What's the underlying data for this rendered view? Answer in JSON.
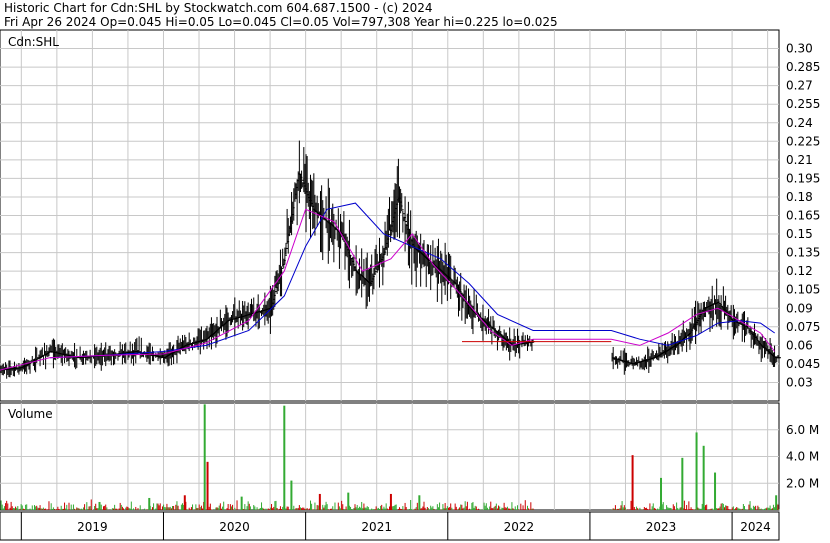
{
  "header": {
    "line1": "Historic Chart for Cdn:SHL by Stockwatch.com 604.687.1500 - (c) 2024",
    "line2": "Fri Apr 26 2024   Op=0.045  Hi=0.05  Lo=0.045  Cl=0.05  Vol=797,308  Year hi=0.225  lo=0.025"
  },
  "colors": {
    "price_bar": "#000000",
    "ma_short": "#cc00cc",
    "ma_long": "#0000cc",
    "vol_up": "#33aa33",
    "vol_down": "#cc0000",
    "grid": "#c8c8c8"
  },
  "chart_data": [
    {
      "type": "line",
      "title": "Cdn:SHL",
      "x_unit": "date (fractional year)",
      "ylim": [
        0.015,
        0.315
      ],
      "y_ticks": [
        "0.30",
        "0.285",
        "0.27",
        "0.255",
        "0.24",
        "0.225",
        "0.21",
        "0.195",
        "0.18",
        "0.165",
        "0.15",
        "0.135",
        "0.12",
        "0.105",
        "0.09",
        "0.075",
        "0.06",
        "0.045",
        "0.03"
      ],
      "grid": true,
      "series": [
        {
          "role": "price_close",
          "x": [
            2018.85,
            2019.0,
            2019.2,
            2019.4,
            2019.6,
            2019.8,
            2020.0,
            2020.15,
            2020.3,
            2020.45,
            2020.6,
            2020.75,
            2020.85,
            2020.95,
            2021.05,
            2021.15,
            2021.25,
            2021.35,
            2021.45,
            2021.55,
            2021.65,
            2021.75,
            2021.85,
            2021.95,
            2022.05,
            2022.15,
            2022.25,
            2022.35,
            2022.45,
            2022.6,
            2023.15,
            2023.3,
            2023.45,
            2023.6,
            2023.7,
            2023.8,
            2023.9,
            2024.0,
            2024.1,
            2024.2,
            2024.3
          ],
          "y": [
            0.04,
            0.042,
            0.055,
            0.05,
            0.052,
            0.055,
            0.05,
            0.06,
            0.065,
            0.08,
            0.085,
            0.09,
            0.13,
            0.2,
            0.17,
            0.16,
            0.15,
            0.12,
            0.11,
            0.135,
            0.18,
            0.14,
            0.13,
            0.12,
            0.11,
            0.09,
            0.08,
            0.07,
            0.06,
            0.063,
            0.05,
            0.045,
            0.05,
            0.06,
            0.07,
            0.09,
            0.095,
            0.08,
            0.075,
            0.06,
            0.05
          ]
        },
        {
          "role": "ma_short",
          "x": [
            2018.85,
            2019.2,
            2019.6,
            2020.0,
            2020.3,
            2020.6,
            2020.85,
            2021.0,
            2021.2,
            2021.4,
            2021.6,
            2021.75,
            2021.9,
            2022.1,
            2022.3,
            2022.45,
            2022.6,
            2023.15,
            2023.35,
            2023.55,
            2023.75,
            2023.9,
            2024.05,
            2024.2,
            2024.3
          ],
          "y": [
            0.04,
            0.05,
            0.052,
            0.053,
            0.062,
            0.08,
            0.12,
            0.17,
            0.16,
            0.12,
            0.13,
            0.15,
            0.125,
            0.1,
            0.072,
            0.06,
            0.065,
            0.065,
            0.06,
            0.07,
            0.085,
            0.09,
            0.08,
            0.07,
            0.055
          ]
        },
        {
          "role": "ma_long",
          "x": [
            2019.2,
            2019.6,
            2020.0,
            2020.3,
            2020.6,
            2020.85,
            2021.0,
            2021.15,
            2021.35,
            2021.55,
            2021.75,
            2021.95,
            2022.15,
            2022.35,
            2022.6,
            2023.15,
            2023.35,
            2023.55,
            2023.75,
            2023.9,
            2024.05,
            2024.2,
            2024.3
          ],
          "y": [
            0.05,
            0.052,
            0.055,
            0.06,
            0.072,
            0.1,
            0.14,
            0.17,
            0.175,
            0.15,
            0.14,
            0.13,
            0.11,
            0.085,
            0.072,
            0.072,
            0.065,
            0.06,
            0.068,
            0.078,
            0.08,
            0.078,
            0.07
          ]
        }
      ]
    },
    {
      "type": "bar",
      "title": "Volume",
      "x_unit": "date (fractional year)",
      "y_unit": "shares (millions)",
      "ylim": [
        0,
        8.0
      ],
      "y_ticks": [
        "6.0 M",
        "4.0 M",
        "2.0 M"
      ],
      "x_ticks": [
        "2019",
        "2020",
        "2021",
        "2022",
        "2023",
        "2024"
      ],
      "x_tick_positions": [
        2019.0,
        2020.0,
        2021.0,
        2022.0,
        2023.0,
        2024.0
      ],
      "xlim": [
        2018.85,
        2024.33
      ],
      "bars": [
        {
          "x": 2019.55,
          "value": 0.6,
          "up": true
        },
        {
          "x": 2019.9,
          "value": 0.9,
          "up": true
        },
        {
          "x": 2020.15,
          "value": 1.1,
          "up": false
        },
        {
          "x": 2020.29,
          "value": 7.9,
          "up": true
        },
        {
          "x": 2020.31,
          "value": 3.6,
          "up": false
        },
        {
          "x": 2020.55,
          "value": 1.0,
          "up": true
        },
        {
          "x": 2020.85,
          "value": 7.8,
          "up": true
        },
        {
          "x": 2020.9,
          "value": 2.2,
          "up": true
        },
        {
          "x": 2021.1,
          "value": 1.2,
          "up": false
        },
        {
          "x": 2021.3,
          "value": 1.3,
          "up": true
        },
        {
          "x": 2021.6,
          "value": 1.2,
          "up": false
        },
        {
          "x": 2021.8,
          "value": 1.1,
          "up": true
        },
        {
          "x": 2023.3,
          "value": 4.1,
          "up": false
        },
        {
          "x": 2023.5,
          "value": 2.4,
          "up": true
        },
        {
          "x": 2023.65,
          "value": 3.9,
          "up": true
        },
        {
          "x": 2023.75,
          "value": 5.8,
          "up": true
        },
        {
          "x": 2023.8,
          "value": 4.8,
          "up": true
        },
        {
          "x": 2023.88,
          "value": 2.8,
          "up": true
        },
        {
          "x": 2024.31,
          "value": 1.1,
          "up": true
        }
      ],
      "noise_volume_max": 0.8
    }
  ]
}
